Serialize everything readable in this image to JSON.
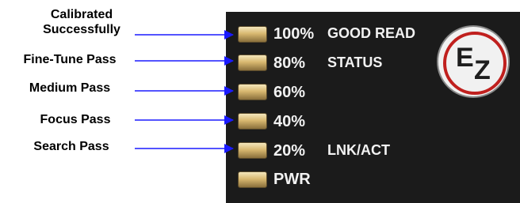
{
  "callouts": [
    {
      "line1": "Calibrated",
      "line2": "Successfully"
    },
    {
      "text": "Fine-Tune Pass"
    },
    {
      "text": "Medium Pass"
    },
    {
      "text": "Focus Pass"
    },
    {
      "text": "Search Pass"
    }
  ],
  "leds": [
    {
      "pct": "100%",
      "label": "GOOD READ"
    },
    {
      "pct": "80%",
      "label": "STATUS"
    },
    {
      "pct": "60%",
      "label": ""
    },
    {
      "pct": "40%",
      "label": ""
    },
    {
      "pct": "20%",
      "label": "LNK/ACT"
    },
    {
      "pct": "PWR",
      "label": ""
    }
  ],
  "logo": {
    "letter_e": "E",
    "letter_z": "Z"
  },
  "colors": {
    "arrow": "#1a1aff",
    "panel": "#1b1b1b",
    "ring": "#c0201e"
  }
}
